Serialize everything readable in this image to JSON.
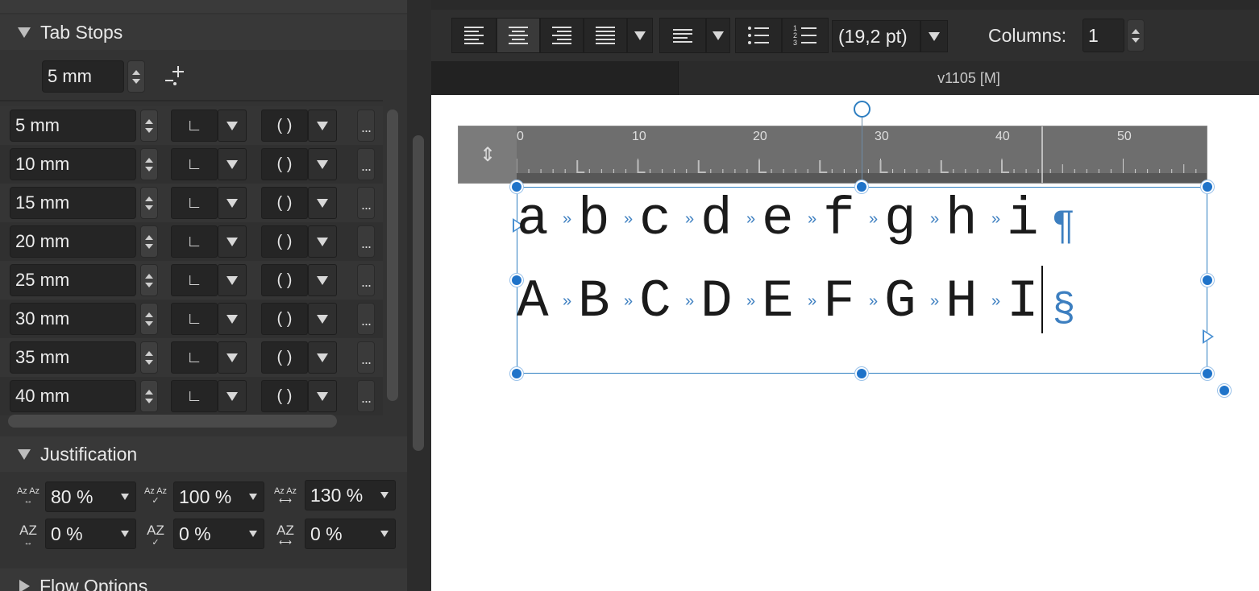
{
  "tab_stops": {
    "title": "Tab Stops",
    "default_spacing": "5 mm",
    "stops": [
      {
        "position": "5 mm",
        "alignment": "∟",
        "leader": "( )",
        "more": "..."
      },
      {
        "position": "10 mm",
        "alignment": "∟",
        "leader": "( )",
        "more": "..."
      },
      {
        "position": "15 mm",
        "alignment": "∟",
        "leader": "( )",
        "more": "..."
      },
      {
        "position": "20 mm",
        "alignment": "∟",
        "leader": "( )",
        "more": "..."
      },
      {
        "position": "25 mm",
        "alignment": "∟",
        "leader": "( )",
        "more": "..."
      },
      {
        "position": "30 mm",
        "alignment": "∟",
        "leader": "( )",
        "more": "..."
      },
      {
        "position": "35 mm",
        "alignment": "∟",
        "leader": "( )",
        "more": "..."
      },
      {
        "position": "40 mm",
        "alignment": "∟",
        "leader": "( )",
        "more": "..."
      }
    ]
  },
  "justification": {
    "title": "Justification",
    "word_spacing_min": "80 %",
    "word_spacing_desired": "100 %",
    "word_spacing_max": "130 %",
    "letter_spacing_min": "0 %",
    "letter_spacing_desired": "0 %",
    "letter_spacing_max": "0 %",
    "icon_text_small": "Az Az",
    "icon_text_big": "AZ"
  },
  "flow_options": {
    "title": "Flow Options"
  },
  "toolbar": {
    "leading": "(19,2 pt)",
    "columns_label": "Columns:",
    "columns_value": "1"
  },
  "document_tab": {
    "label": "v1105  [M]"
  },
  "ruler": {
    "ticks": [
      "0",
      "10",
      "20",
      "30",
      "40",
      "50"
    ]
  },
  "text_frame": {
    "line1": [
      "a",
      "b",
      "c",
      "d",
      "e",
      "f",
      "g",
      "h",
      "i"
    ],
    "line2": [
      "A",
      "B",
      "C",
      "D",
      "E",
      "F",
      "G",
      "H",
      "I"
    ],
    "tab_mark": "»",
    "paragraph_mark": "¶",
    "section_mark": "§"
  },
  "colors": {
    "panel_bg": "#333333",
    "selection_blue": "#1f73c9",
    "invisible_char": "#3d7fc0"
  }
}
